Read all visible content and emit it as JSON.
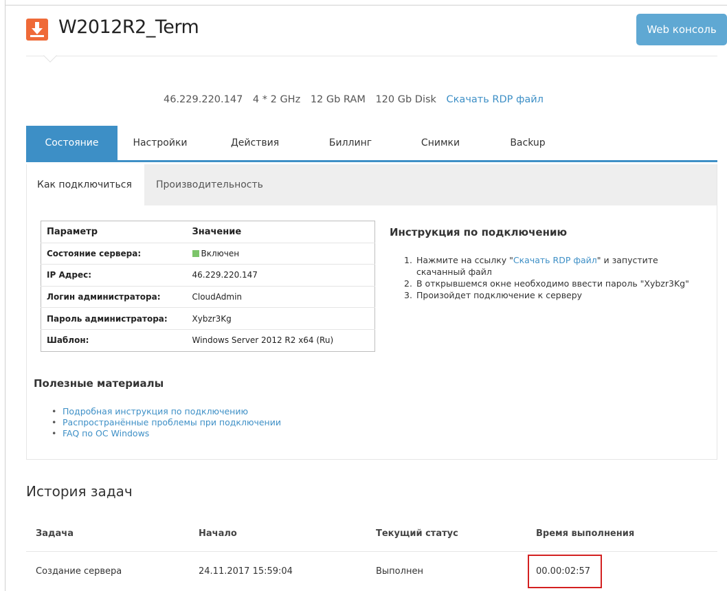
{
  "header": {
    "icon": "download-icon",
    "server_name": "W2012R2_Term",
    "web_console_label": "Web консоль"
  },
  "summary": {
    "ip": "46.229.220.147",
    "cpu": "4 * 2 GHz",
    "ram": "12 Gb RAM",
    "disk": "120 Gb Disk",
    "rdp_link": "Скачать RDP файл"
  },
  "main_tabs": [
    "Состояние",
    "Настройки",
    "Действия",
    "Биллинг",
    "Снимки",
    "Backup"
  ],
  "sub_tabs": [
    "Как подключиться",
    "Производительность"
  ],
  "info_table": {
    "header": [
      "Параметр",
      "Значение"
    ],
    "rows": [
      [
        "Состояние сервера:",
        "Включен"
      ],
      [
        "IP Адрес:",
        "46.229.220.147"
      ],
      [
        "Логин администратора:",
        "CloudAdmin"
      ],
      [
        "Пароль администратора:",
        "Xybzr3Kg"
      ],
      [
        "Шаблон:",
        "Windows Server 2012 R2 x64 (Ru)"
      ]
    ],
    "status_color": "#7cc46a"
  },
  "instructions": {
    "title": "Инструкция по подключению",
    "steps": {
      "n1": "1.",
      "s1_pre": "Нажмите на ссылку \"",
      "s1_link": "Скачать RDP файл",
      "s1_post": "\" и запустите скачанный файл",
      "n2": "2.",
      "s2": "В открывшемся окне необходимо ввести пароль \"Xybzr3Kg\"",
      "n3": "3.",
      "s3": "Произойдет подключение к серверу"
    }
  },
  "useful": {
    "title": "Полезные материалы",
    "links": [
      "Подробная инструкция по подключению",
      "Распространённые проблемы при подключении",
      "FAQ по ОС Windows"
    ]
  },
  "history": {
    "title": "История задач",
    "columns": [
      "Задача",
      "Начало",
      "Текущий статус",
      "Время выполнения"
    ],
    "rows": [
      [
        "Создание сервера",
        "24.11.2017 15:59:04",
        "Выполнен",
        "00.00:02:57"
      ]
    ]
  },
  "colors": {
    "accent": "#3d8fc6",
    "web_console_button": "#5fa8d3",
    "app_icon": "#ef6a38",
    "highlight": "#d32020"
  }
}
